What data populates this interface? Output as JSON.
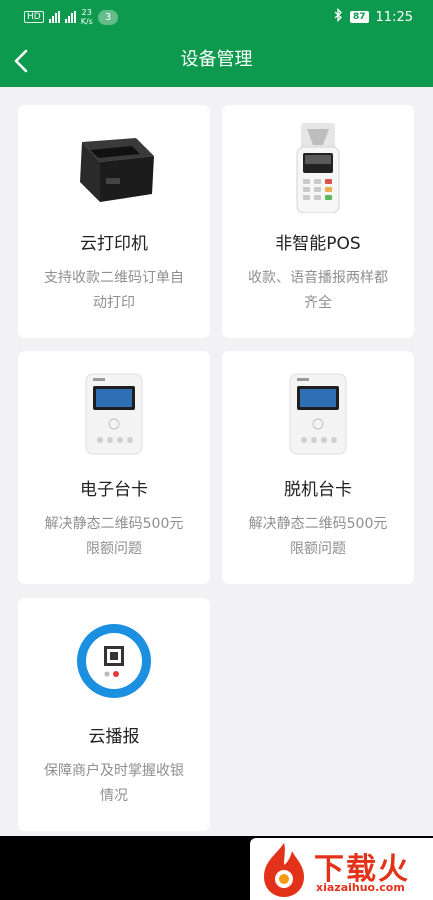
{
  "status_bar": {
    "left_chip": "HD",
    "speed_value": "23",
    "speed_unit": "K/s",
    "notification_count": "3",
    "battery": "87",
    "time": "11:25"
  },
  "header": {
    "title": "设备管理"
  },
  "devices": [
    {
      "title": "云打印机",
      "desc": "支持收款二维码订单自动打印"
    },
    {
      "title": "非智能POS",
      "desc": "收款、语音播报两样都齐全"
    },
    {
      "title": "电子台卡",
      "desc": "解决静态二维码500元限额问题"
    },
    {
      "title": "脱机台卡",
      "desc": "解决静态二维码500元限额问题"
    },
    {
      "title": "云播报",
      "desc": "保障商户及时掌握收银情况"
    }
  ],
  "watermark": {
    "name": "下载火",
    "domain": "xiazaihuo.com"
  },
  "colors": {
    "primary": "#0e9a4e",
    "background": "#f2f2f4",
    "watermark": "#e3321a"
  }
}
